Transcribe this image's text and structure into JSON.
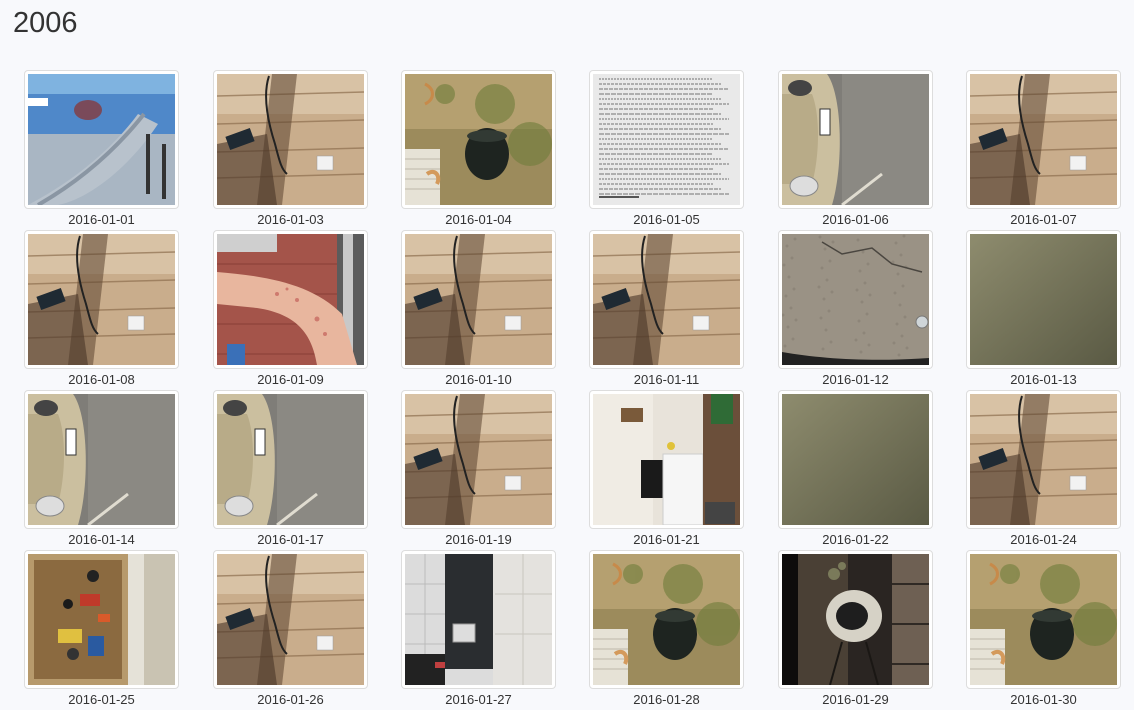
{
  "page": {
    "title": "2006"
  },
  "photos": [
    {
      "date": "2016-01-01",
      "scene": "slide"
    },
    {
      "date": "2016-01-03",
      "scene": "deck"
    },
    {
      "date": "2016-01-04",
      "scene": "yard"
    },
    {
      "date": "2016-01-05",
      "scene": "document"
    },
    {
      "date": "2016-01-06",
      "scene": "car"
    },
    {
      "date": "2016-01-07",
      "scene": "deck"
    },
    {
      "date": "2016-01-08",
      "scene": "deck"
    },
    {
      "date": "2016-01-09",
      "scene": "arm"
    },
    {
      "date": "2016-01-10",
      "scene": "deck"
    },
    {
      "date": "2016-01-11",
      "scene": "deck"
    },
    {
      "date": "2016-01-12",
      "scene": "concrete"
    },
    {
      "date": "2016-01-13",
      "scene": "olive"
    },
    {
      "date": "2016-01-14",
      "scene": "car"
    },
    {
      "date": "2016-01-17",
      "scene": "car"
    },
    {
      "date": "2016-01-19",
      "scene": "deck"
    },
    {
      "date": "2016-01-21",
      "scene": "kitchen"
    },
    {
      "date": "2016-01-22",
      "scene": "olive"
    },
    {
      "date": "2016-01-24",
      "scene": "deck"
    },
    {
      "date": "2016-01-25",
      "scene": "box"
    },
    {
      "date": "2016-01-26",
      "scene": "deck"
    },
    {
      "date": "2016-01-27",
      "scene": "appliance"
    },
    {
      "date": "2016-01-28",
      "scene": "yard"
    },
    {
      "date": "2016-01-29",
      "scene": "bowl"
    },
    {
      "date": "2016-01-30",
      "scene": "yard"
    }
  ]
}
